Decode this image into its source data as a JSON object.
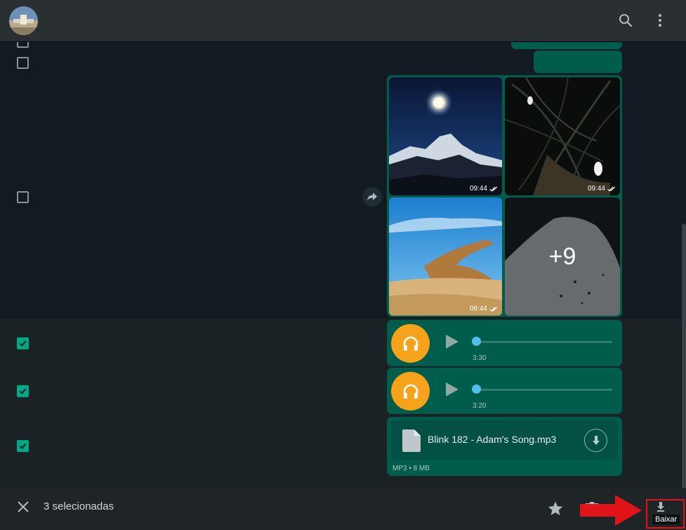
{
  "header": {
    "avatar_icon": "landscape-avatar",
    "search_icon": "search-icon",
    "menu_icon": "kebab-menu-icon"
  },
  "messages": {
    "album": {
      "tiles": [
        {
          "time": "09:44",
          "status_icon": "double-check-icon"
        },
        {
          "time": "09:44",
          "status_icon": "double-check-icon"
        },
        {
          "time": "09:44",
          "status_icon": "double-check-icon"
        },
        {
          "more_count": "+9"
        }
      ]
    },
    "audio": [
      {
        "duration": "3:30",
        "icon": "headphones-icon",
        "progress": 0
      },
      {
        "duration": "3:20",
        "icon": "headphones-icon",
        "progress": 0
      }
    ],
    "document": {
      "filename": "Blink 182 - Adam's Song.mp3",
      "meta": "MP3 • 8 MB",
      "icon": "file-icon"
    }
  },
  "footer": {
    "selected_label": "3 selecionadas",
    "download_label": "Baixar"
  },
  "colors": {
    "bubble": "#005c4b",
    "checkbox_on": "#00a884",
    "audio_avatar": "#f7a21b",
    "highlight": "#e1141a"
  }
}
